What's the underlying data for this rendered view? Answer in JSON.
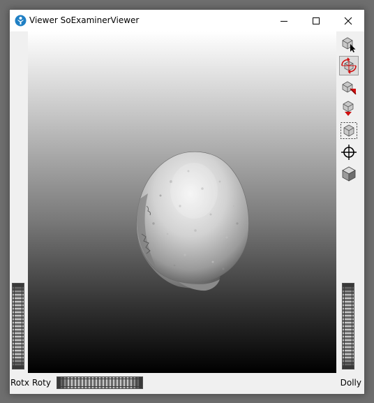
{
  "window": {
    "title": "Viewer SoExaminerViewer",
    "controls": [
      "minimize-icon",
      "maximize-icon",
      "close-icon"
    ]
  },
  "toolbar": {
    "tools": [
      {
        "name": "pick-mode",
        "icon": "cube-arrow-icon",
        "active": false
      },
      {
        "name": "view-mode",
        "icon": "rotate-cube-icon",
        "active": true
      },
      {
        "name": "home",
        "icon": "cube-home-icon",
        "active": false
      },
      {
        "name": "set-home",
        "icon": "cube-down-icon",
        "active": false
      },
      {
        "name": "view-all",
        "icon": "view-all-icon",
        "active": false
      },
      {
        "name": "seek",
        "icon": "crosshair-icon",
        "active": false
      },
      {
        "name": "projection",
        "icon": "shaded-cube-icon",
        "active": false
      }
    ]
  },
  "bottom": {
    "rotx_label": "Rotx",
    "roty_label": "Roty",
    "dolly_label": "Dolly"
  },
  "viewport": {
    "model": "skull-mesh"
  },
  "colors": {
    "background_top": "#ffffff",
    "background_bottom": "#000000",
    "active_tool_accent": "#d01010"
  }
}
